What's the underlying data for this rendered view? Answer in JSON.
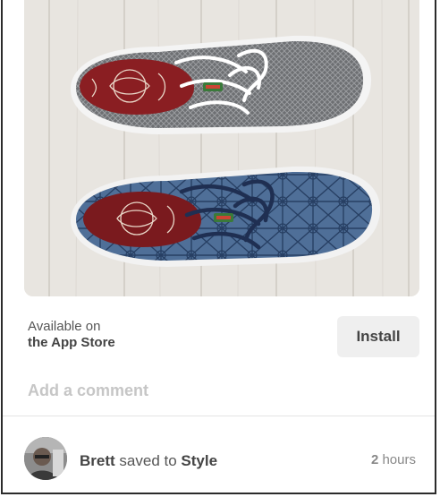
{
  "pin": {
    "image_alt": "Two canvas sneakers on a white wooden floor",
    "image_icon": "shoe-photo"
  },
  "install": {
    "available_prefix": "Available on",
    "store_name": "the App Store",
    "button_label": "Install"
  },
  "comment": {
    "placeholder": "Add a comment"
  },
  "activity": {
    "user": "Brett",
    "action": "saved to",
    "board": "Style",
    "time_value": "2",
    "time_unit": "hours"
  }
}
